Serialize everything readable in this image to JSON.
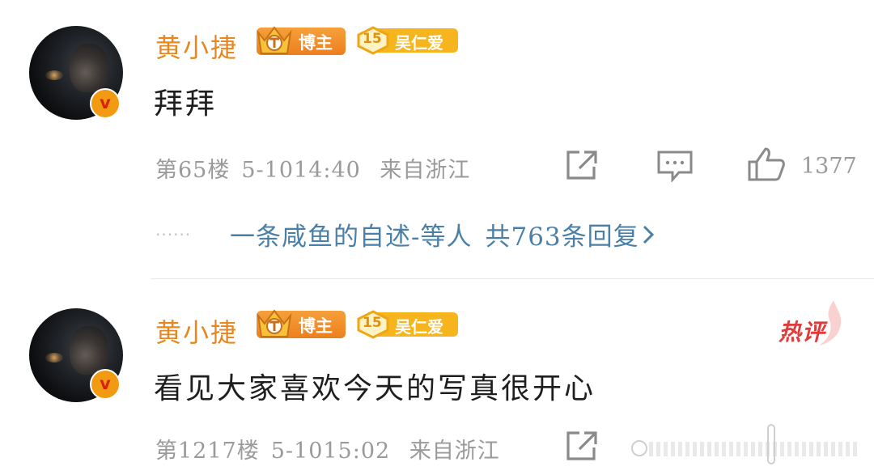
{
  "comments": [
    {
      "author": "黄小捷",
      "role_badge": "博主",
      "fan_badge": {
        "level": "15",
        "label": "吴仁爱"
      },
      "text": "拜拜",
      "meta": {
        "floor": "第65楼",
        "time": "5-1014:40",
        "location": "来自浙江"
      },
      "likes": "1377",
      "replies": {
        "from": "一条咸鱼的自述-",
        "suffix": "等人",
        "count_text": "共763条回复"
      }
    },
    {
      "author": "黄小捷",
      "role_badge": "博主",
      "fan_badge": {
        "level": "15",
        "label": "吴仁爱"
      },
      "hot_label": "热评",
      "text": "看见大家喜欢今天的写真很开心",
      "meta": {
        "floor": "第1217楼",
        "time": "5-1015:02",
        "location": "来自浙江"
      }
    }
  ],
  "colors": {
    "author": "#e8871f",
    "reply_link": "#4a7fa8",
    "meta": "#9a9a9a",
    "badge_orange": "#ec7f1e",
    "badge_gold": "#f6b51c",
    "hot": "#e03b3b"
  },
  "icons": [
    "verified-icon",
    "crown-icon",
    "share-icon",
    "comment-icon",
    "like-icon",
    "chevron-right-icon",
    "flame-icon"
  ]
}
